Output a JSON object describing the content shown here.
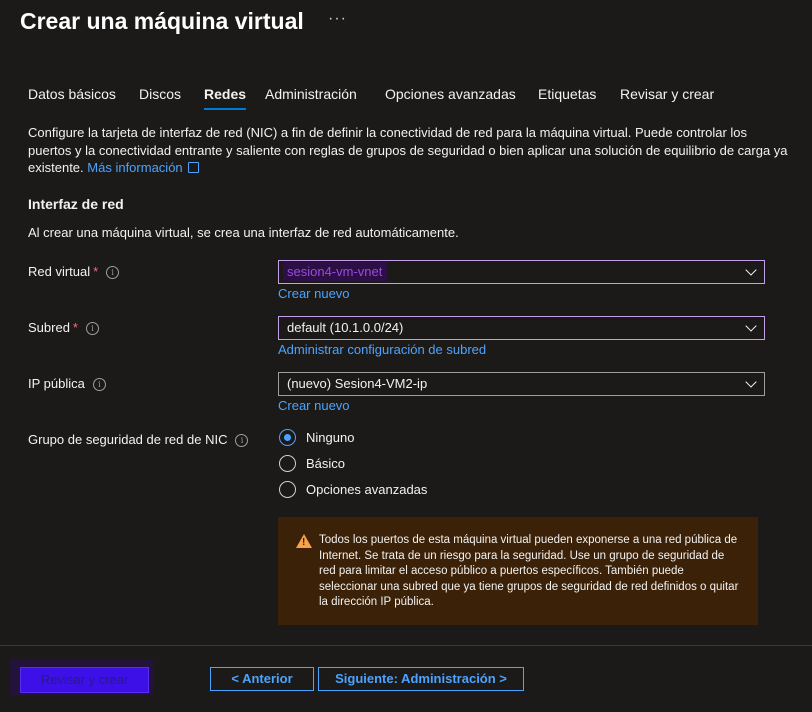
{
  "page": {
    "title": "Crear una máquina virtual",
    "more_label": "···"
  },
  "tabs": [
    {
      "label": "Datos básicos"
    },
    {
      "label": "Discos"
    },
    {
      "label": "Redes",
      "active": true
    },
    {
      "label": "Administración"
    },
    {
      "label": "Opciones avanzadas"
    },
    {
      "label": "Etiquetas"
    },
    {
      "label": "Revisar y crear"
    }
  ],
  "description": {
    "text": "Configure la tarjeta de interfaz de red (NIC) a fin de definir la conectividad de red para la máquina virtual. Puede controlar los puertos y la conectividad entrante y saliente con reglas de grupos de seguridad o bien aplicar una solución de equilibrio de carga ya existente.",
    "link": "Más información"
  },
  "section": {
    "title": "Interfaz de red",
    "subtitle": "Al crear una máquina virtual, se crea una interfaz de red automáticamente."
  },
  "fields": {
    "vnet": {
      "label": "Red virtual",
      "value": "sesion4-vm-vnet",
      "link": "Crear nuevo",
      "required": "*"
    },
    "subnet": {
      "label": "Subred",
      "value": "default (10.1.0.0/24)",
      "link": "Administrar configuración de subred",
      "required": "*"
    },
    "public_ip": {
      "label": "IP pública",
      "value": "(nuevo) Sesion4-VM2-ip",
      "link": "Crear nuevo"
    },
    "nsg": {
      "label": "Grupo de seguridad de red de NIC",
      "options": [
        {
          "label": "Ninguno",
          "selected": true
        },
        {
          "label": "Básico",
          "selected": false
        },
        {
          "label": "Opciones avanzadas",
          "selected": false
        }
      ]
    }
  },
  "warning": {
    "text": "Todos los puertos de esta máquina virtual pueden exponerse a una red pública de Internet. Se trata de un riesgo para la seguridad. Use un grupo de seguridad de red para limitar el acceso público a puertos específicos. También puede seleccionar una subred que ya tiene grupos de seguridad de red definidos o quitar la dirección IP pública."
  },
  "footer": {
    "review_create": "Revisar y crear",
    "previous": "< Anterior",
    "next": "Siguiente: Administración >"
  },
  "colors": {
    "accent": "#0078d4",
    "link": "#4ca3ff",
    "warning_bg": "#3b2107",
    "warning_icon": "#f7a14a",
    "background": "#1b1a19"
  }
}
